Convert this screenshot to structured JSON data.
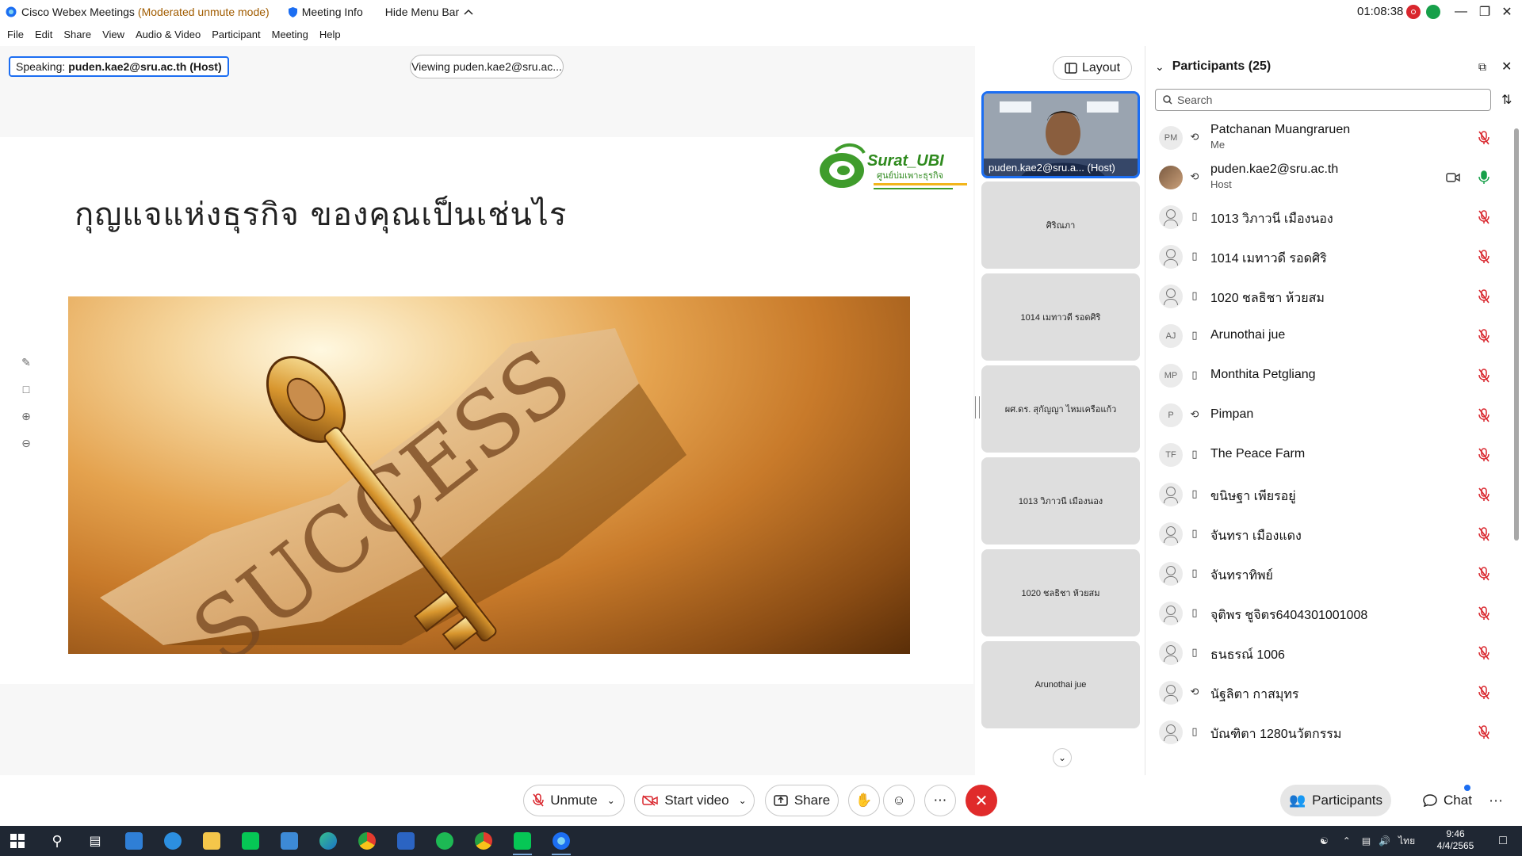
{
  "titlebar": {
    "app_name": "Cisco Webex Meetings",
    "mode": "(Moderated unmute mode)",
    "meeting_info": "Meeting Info",
    "hide_menu_bar": "Hide Menu Bar",
    "elapsed_time": "01:08:38"
  },
  "menu": [
    "File",
    "Edit",
    "Share",
    "View",
    "Audio & Video",
    "Participant",
    "Meeting",
    "Help"
  ],
  "stage": {
    "speaking_label": "Speaking:",
    "speaking_name": "puden.kae2@sru.ac.th (Host)",
    "viewing": "Viewing puden.kae2@sru.ac...",
    "slide_title": "กุญแจแห่งธุรกิจ ของคุณเป็นเช่นไร",
    "logo_text": "Surat_UBI",
    "logo_subtext": "ศูนย์บ่มเพาะธุรกิจ",
    "photo_word": "SUCCESS"
  },
  "strip": {
    "layout_label": "Layout",
    "host_label": "puden.kae2@sru.a... (Host)",
    "tiles": [
      "ศิริณภา",
      "1014 เมทาวดี รอดศิริ",
      "ผศ.ดร. สุกัญญา ไหมเครือแก้ว",
      "1013 วิภาวนี เมืองนอง",
      "1020 ชลธิชา ห้วยสม",
      "Arunothai jue"
    ]
  },
  "participants": {
    "title": "Participants (25)",
    "search_placeholder": "Search",
    "items": [
      {
        "initials": "PM",
        "name": "Patchanan Muangraruen",
        "sub": "Me",
        "device": "audio",
        "muted": true
      },
      {
        "initials": "",
        "name": "puden.kae2@sru.ac.th",
        "sub": "Host",
        "device": "audio",
        "muted": false,
        "photo": true,
        "video": true
      },
      {
        "initials": "",
        "name": "1013 วิภาวนี เมืองนอง",
        "sub": "",
        "device": "phone",
        "muted": true
      },
      {
        "initials": "",
        "name": "1014 เมทาวดี รอดศิริ",
        "sub": "",
        "device": "phone",
        "muted": true
      },
      {
        "initials": "",
        "name": "1020 ชลธิชา ห้วยสม",
        "sub": "",
        "device": "phone",
        "muted": true
      },
      {
        "initials": "AJ",
        "name": "Arunothai jue",
        "sub": "",
        "device": "phone",
        "muted": true
      },
      {
        "initials": "MP",
        "name": "Monthita Petgliang",
        "sub": "",
        "device": "phone",
        "muted": true
      },
      {
        "initials": "P",
        "name": "Pimpan",
        "sub": "",
        "device": "audio",
        "muted": true
      },
      {
        "initials": "TF",
        "name": "The Peace Farm",
        "sub": "",
        "device": "phone",
        "muted": true
      },
      {
        "initials": "",
        "name": "ขนิษฐา เพียรอยู่",
        "sub": "",
        "device": "phone",
        "muted": true
      },
      {
        "initials": "",
        "name": "จันทรา เมืองแดง",
        "sub": "",
        "device": "phone",
        "muted": true
      },
      {
        "initials": "",
        "name": "จันทราทิพย์",
        "sub": "",
        "device": "phone",
        "muted": true
      },
      {
        "initials": "",
        "name": "จุติพร ชูจิตร6404301001008",
        "sub": "",
        "device": "phone",
        "muted": true
      },
      {
        "initials": "",
        "name": "ธนธรณ์ 1006",
        "sub": "",
        "device": "phone",
        "muted": true
      },
      {
        "initials": "",
        "name": "นัฐลิตา กาสมุทร",
        "sub": "",
        "device": "audio",
        "muted": true
      },
      {
        "initials": "",
        "name": "บัณฑิตา 1280นวัตกรรม",
        "sub": "",
        "device": "phone",
        "muted": true
      }
    ]
  },
  "controls": {
    "unmute": "Unmute",
    "start_video": "Start video",
    "share": "Share",
    "participants_tab": "Participants",
    "chat_tab": "Chat"
  },
  "taskbar": {
    "time": "9:46",
    "date": "4/4/2565",
    "lang": "ไทย"
  },
  "colors": {
    "accent": "#1c6ef2",
    "end": "#e02b2b",
    "mute": "#d9262d",
    "unmuted": "#17a04a",
    "mode_text": "#a15c00"
  }
}
